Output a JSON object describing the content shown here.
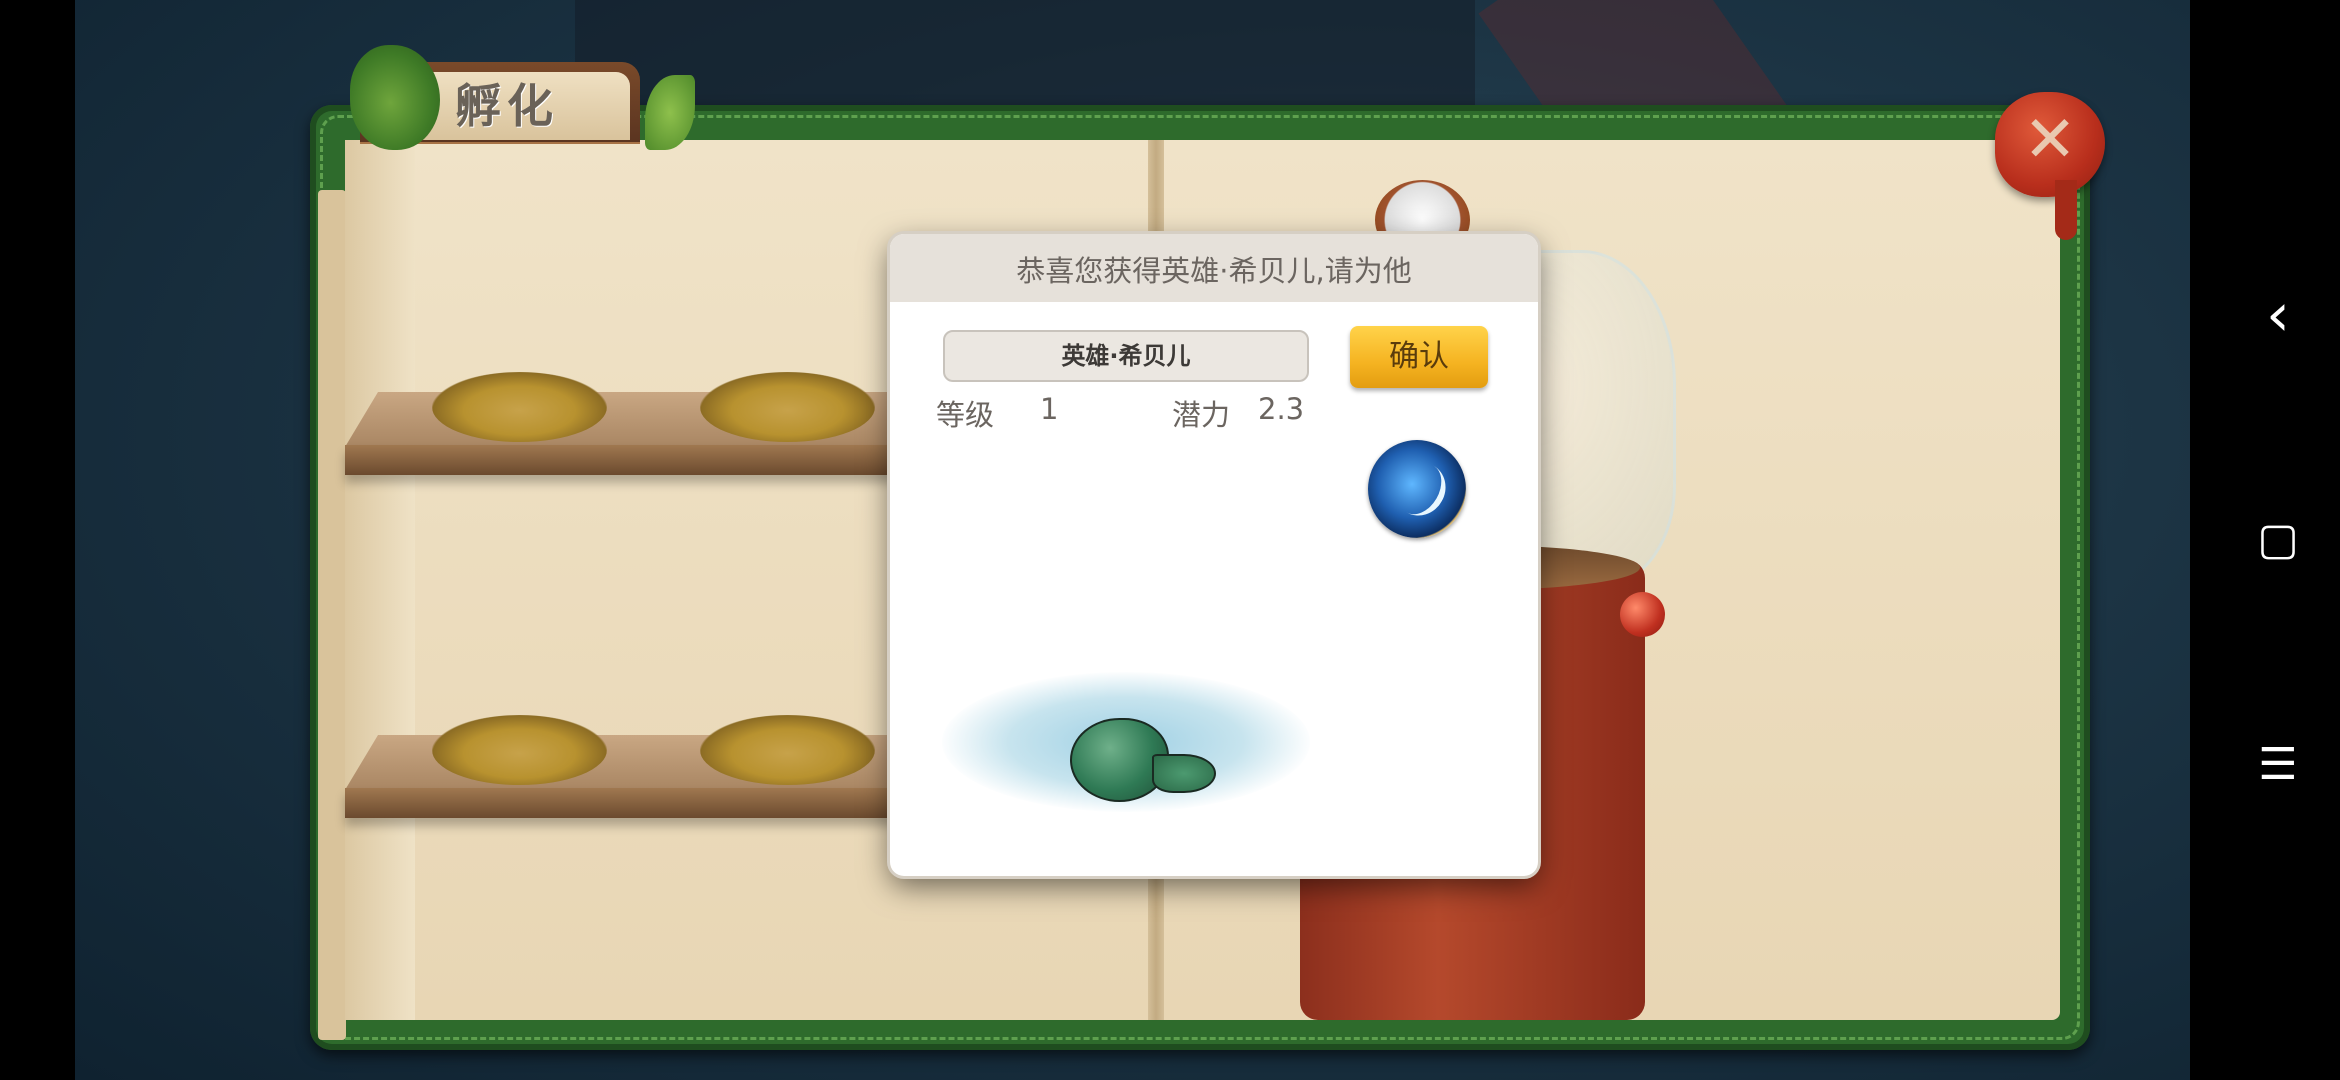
{
  "tab": {
    "title": "孵化"
  },
  "dialog": {
    "title": "恭喜您获得英雄·希贝儿,请为他",
    "hero_name": "英雄·希贝儿",
    "confirm_label": "确认",
    "level_label": "等级",
    "level_value": "1",
    "potential_label": "潜力",
    "potential_value": "2.3"
  },
  "close": {
    "symbol": "✕"
  },
  "nav": {
    "back": "‹",
    "home": "▢",
    "menu": "☰"
  },
  "colors": {
    "frame_green": "#2e6b2c",
    "confirm_yellow": "#f5b321",
    "close_red": "#b82e1c"
  }
}
